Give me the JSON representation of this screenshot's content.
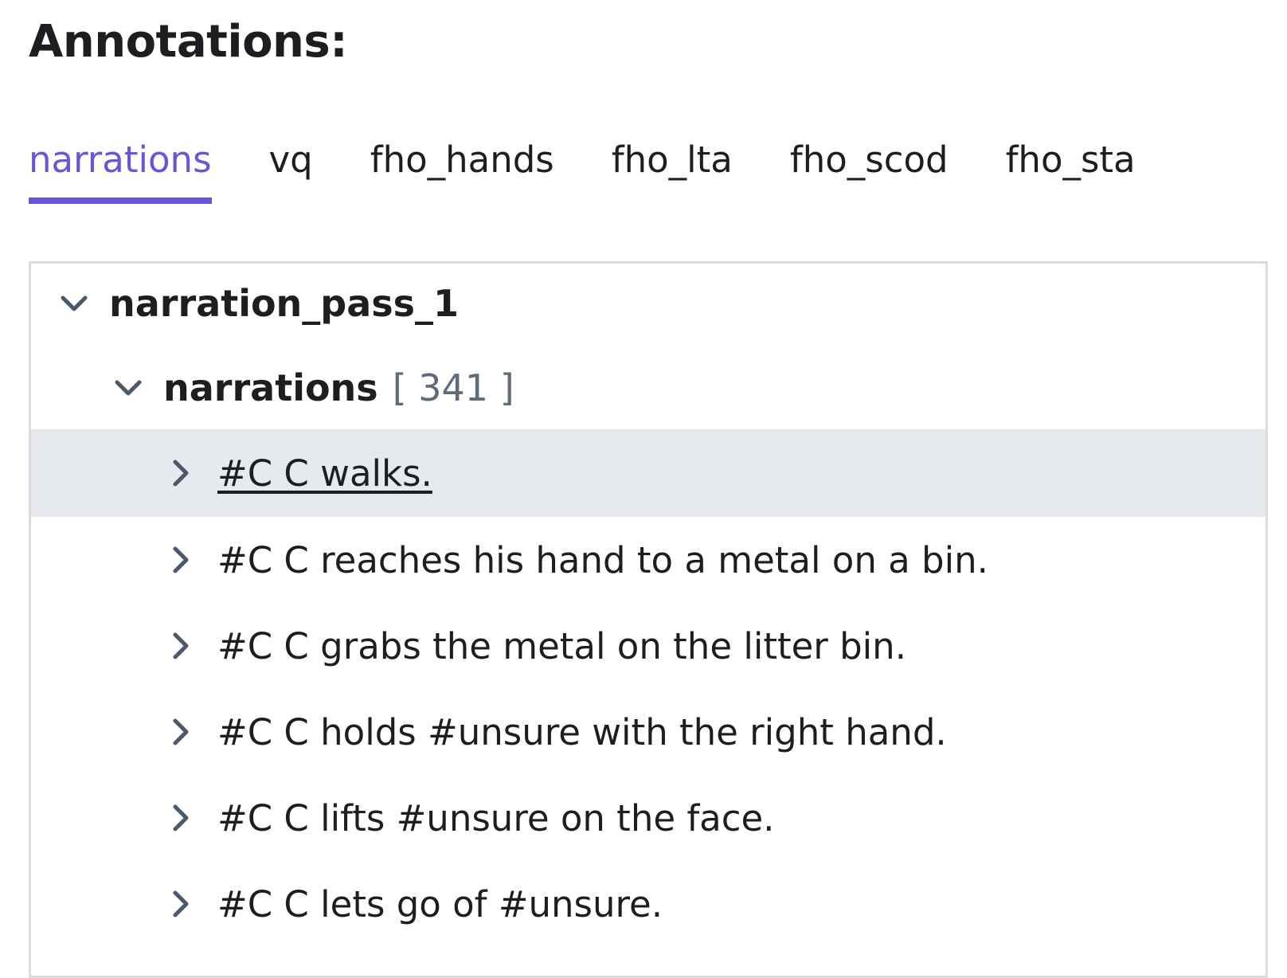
{
  "heading": "Annotations:",
  "tabs": [
    {
      "label": "narrations",
      "active": true
    },
    {
      "label": "vq",
      "active": false
    },
    {
      "label": "fho_hands",
      "active": false
    },
    {
      "label": "fho_lta",
      "active": false
    },
    {
      "label": "fho_scod",
      "active": false
    },
    {
      "label": "fho_sta",
      "active": false
    }
  ],
  "colors": {
    "accent": "#6c54d8",
    "highlight_row": "#e6e9ee",
    "border": "#dcdcdc",
    "count_text": "#5f6b7a",
    "chevron": "#4a5a6a"
  },
  "tree": {
    "pass": {
      "label": "narration_pass_1",
      "expanded": true
    },
    "group": {
      "label": "narrations",
      "count": "[ 341 ]",
      "expanded": true
    },
    "items": [
      {
        "text": "#C C walks.",
        "highlighted": true
      },
      {
        "text": "#C C reaches his hand to a metal on a bin.",
        "highlighted": false
      },
      {
        "text": "#C C grabs the metal on the litter bin.",
        "highlighted": false
      },
      {
        "text": "#C C holds #unsure with the right hand.",
        "highlighted": false
      },
      {
        "text": "#C C lifts #unsure on the face.",
        "highlighted": false
      },
      {
        "text": "#C C lets go of #unsure.",
        "highlighted": false
      }
    ]
  },
  "icons": {
    "expanded": "chevron-down-icon",
    "collapsed": "chevron-right-icon"
  }
}
